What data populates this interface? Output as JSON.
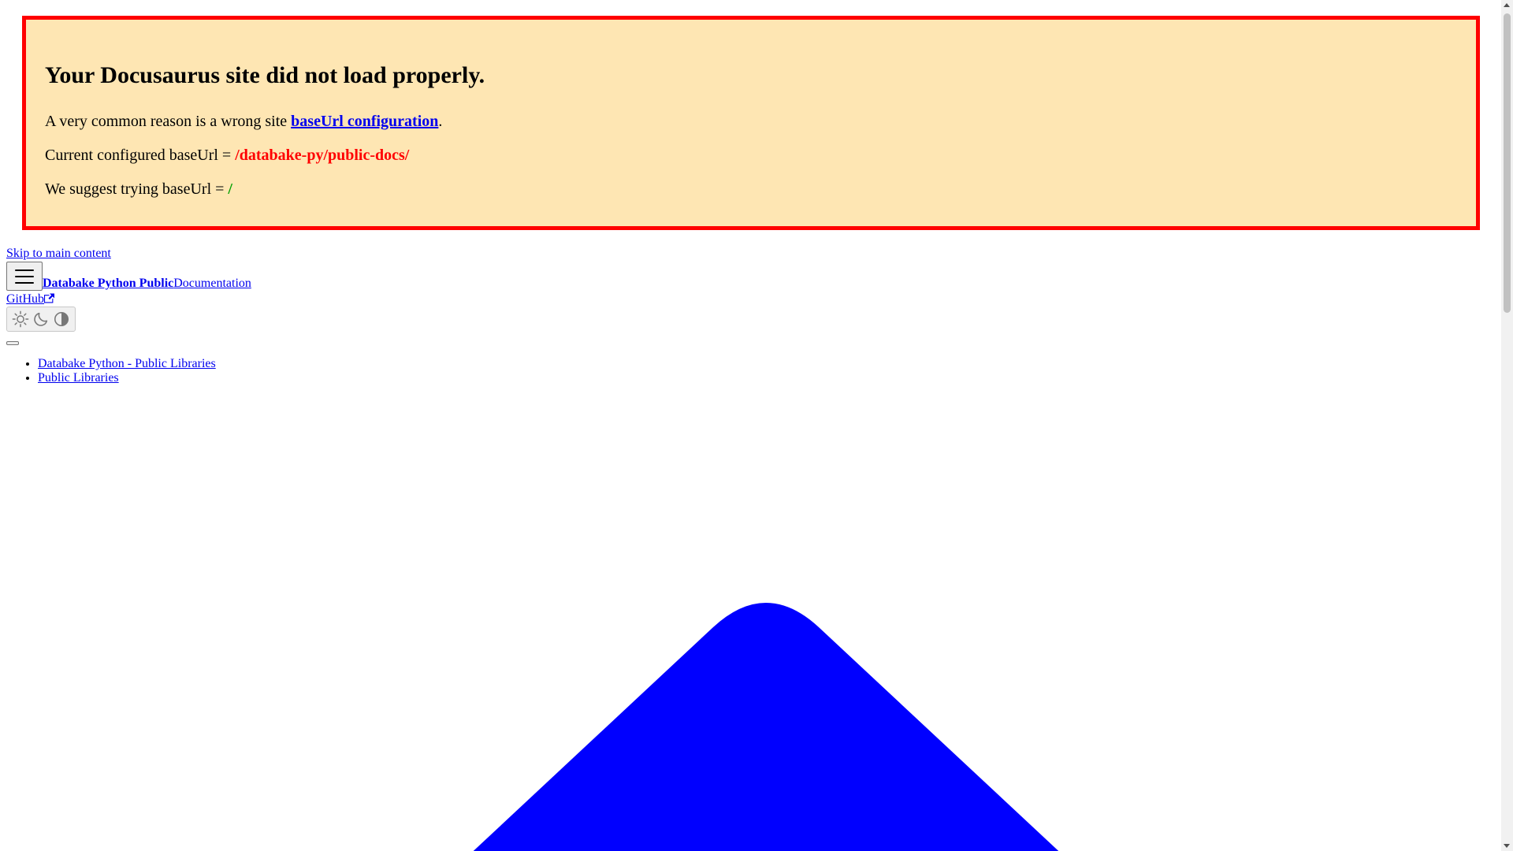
{
  "banner": {
    "title": "Your Docusaurus site did not load properly.",
    "reason_prefix": "A very common reason is a wrong site ",
    "reason_link": "baseUrl configuration",
    "reason_suffix": ".",
    "current_prefix": "Current configured baseUrl = ",
    "current_value": "/databake-py/public-docs/",
    "suggest_prefix": "We suggest trying baseUrl = ",
    "suggest_value": "/"
  },
  "nav": {
    "skip_link": "Skip to main content",
    "menu_icon": "hamburger-icon",
    "brand_title": "Databake Python Public",
    "brand_subtitle": "Documentation",
    "github_label": "GitHub",
    "theme_icons": [
      "sun-icon",
      "moon-icon",
      "half-circle-icon"
    ]
  },
  "breadcrumbs": [
    "Databake Python - Public Libraries",
    "Public Libraries"
  ],
  "colors": {
    "banner_bg": "#fee6b3",
    "banner_border": "#ff0000",
    "link": "#0000ee",
    "bad_url": "#ff0000",
    "good_url": "#00a000",
    "chevron": "#0000ff"
  }
}
